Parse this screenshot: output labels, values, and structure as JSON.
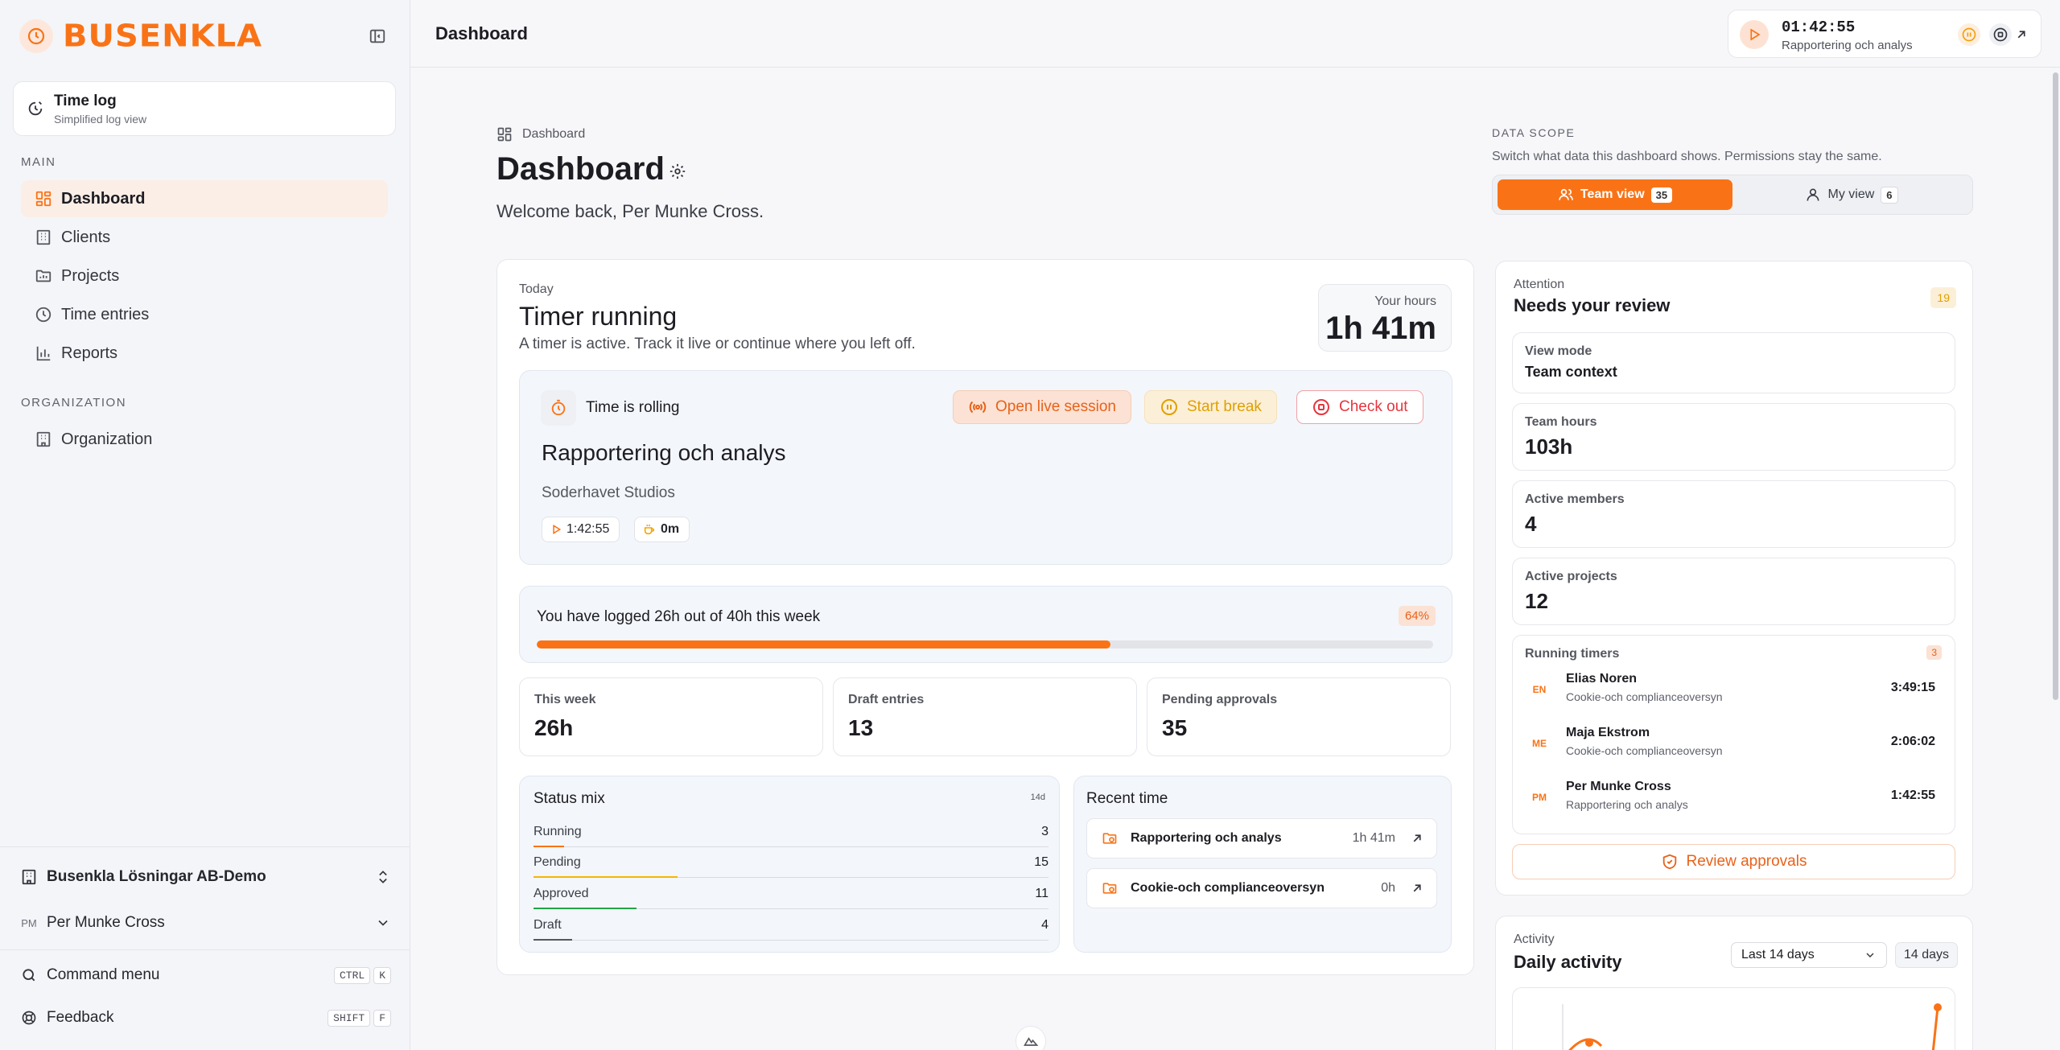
{
  "app": {
    "brand": "BUSENKLA",
    "brand_color": "#f97316"
  },
  "sidebar": {
    "timelog": {
      "title": "Time log",
      "subtitle": "Simplified log view"
    },
    "main_label": "MAIN",
    "items": [
      {
        "label": "Dashboard",
        "icon": "dashboard-icon",
        "active": true
      },
      {
        "label": "Clients",
        "icon": "building-icon"
      },
      {
        "label": "Projects",
        "icon": "folder-icon"
      },
      {
        "label": "Time entries",
        "icon": "clock-icon"
      },
      {
        "label": "Reports",
        "icon": "bar-chart-icon"
      }
    ],
    "org_label": "ORGANIZATION",
    "org_items": [
      {
        "label": "Organization",
        "icon": "building-icon"
      }
    ],
    "workspace": "Busenkla Lösningar AB-Demo",
    "user": {
      "initials": "PM",
      "name": "Per Munke Cross"
    },
    "command_menu": {
      "label": "Command menu",
      "keys": [
        "CTRL",
        "K"
      ]
    },
    "feedback": {
      "label": "Feedback",
      "keys": [
        "SHIFT",
        "F"
      ]
    }
  },
  "topbar": {
    "title": "Dashboard",
    "timer": {
      "time": "01:42:55",
      "project": "Rapportering och analys"
    }
  },
  "page": {
    "breadcrumb": "Dashboard",
    "title": "Dashboard",
    "welcome": "Welcome back, Per Munke Cross.",
    "scope": {
      "label": "DATA SCOPE",
      "description": "Switch what data this dashboard shows. Permissions stay the same.",
      "team": {
        "label": "Team view",
        "count": "35"
      },
      "mine": {
        "label": "My view",
        "count": "6"
      }
    }
  },
  "today": {
    "eyebrow": "Today",
    "title": "Timer running",
    "description": "A timer is active. Track it live or continue where you left off.",
    "hours_label": "Your hours",
    "hours_value": "1h 41m",
    "rolling_label": "Time is rolling",
    "open_live": "Open live session",
    "start_break": "Start break",
    "check_out": "Check out",
    "project": "Rapportering och analys",
    "client": "Soderhavet Studios",
    "elapsed": "1:42:55",
    "break_time": "0m",
    "progress_text": "You have logged 26h out of 40h this week",
    "progress_pct_label": "64%",
    "progress_fraction": 0.64,
    "stats": [
      {
        "label": "This week",
        "value": "26h"
      },
      {
        "label": "Draft entries",
        "value": "13"
      },
      {
        "label": "Pending approvals",
        "value": "35"
      }
    ],
    "status_mix": {
      "title": "Status mix",
      "period": "14d",
      "rows": [
        {
          "label": "Running",
          "value": "3",
          "fraction": 0.06,
          "color": "#f97316"
        },
        {
          "label": "Pending",
          "value": "15",
          "fraction": 0.28,
          "color": "#f5b700"
        },
        {
          "label": "Approved",
          "value": "11",
          "fraction": 0.2,
          "color": "#22a447"
        },
        {
          "label": "Draft",
          "value": "4",
          "fraction": 0.075,
          "color": "#55575f"
        }
      ]
    },
    "recent": {
      "title": "Recent time",
      "items": [
        {
          "name": "Rapportering och analys",
          "duration": "1h 41m"
        },
        {
          "name": "Cookie-och complianceoversyn",
          "duration": "0h"
        }
      ]
    }
  },
  "attention": {
    "eyebrow": "Attention",
    "title": "Needs your review",
    "badge": "19",
    "view_mode_label": "View mode",
    "view_mode_value": "Team context",
    "metrics": [
      {
        "label": "Team hours",
        "value": "103h"
      },
      {
        "label": "Active members",
        "value": "4"
      },
      {
        "label": "Active projects",
        "value": "12"
      }
    ],
    "running_label": "Running timers",
    "running_count": "3",
    "timers": [
      {
        "initials": "EN",
        "name": "Elias Noren",
        "project": "Cookie-och complianceoversyn",
        "time": "3:49:15"
      },
      {
        "initials": "ME",
        "name": "Maja Ekstrom",
        "project": "Cookie-och complianceoversyn",
        "time": "2:06:02"
      },
      {
        "initials": "PM",
        "name": "Per Munke Cross",
        "project": "Rapportering och analys",
        "time": "1:42:55"
      }
    ],
    "review_button": "Review approvals"
  },
  "activity": {
    "eyebrow": "Activity",
    "title": "Daily activity",
    "range_select": "Last 14 days",
    "range_badge": "14 days"
  }
}
